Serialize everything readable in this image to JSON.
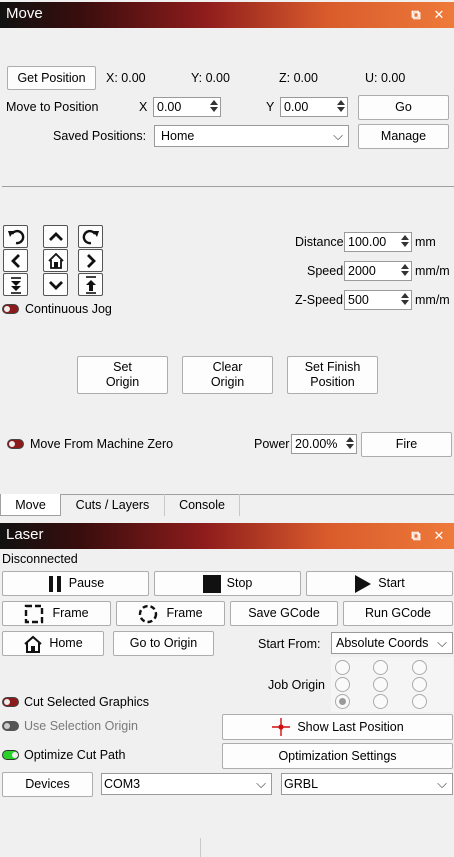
{
  "move_panel": {
    "title": "Move",
    "get_position_label": "Get Position",
    "x_readout": "X: 0.00",
    "y_readout": "Y: 0.00",
    "z_readout": "Z: 0.00",
    "u_readout": "U: 0.00",
    "move_to_position_label": "Move to Position",
    "x_label": "X",
    "x_value": "0.00",
    "y_label": "Y",
    "y_value": "0.00",
    "go_label": "Go",
    "saved_positions_label": "Saved Positions:",
    "saved_positions_value": "Home",
    "manage_label": "Manage",
    "distance_label": "Distance",
    "distance_value": "100.00",
    "distance_unit": "mm",
    "speed_label": "Speed",
    "speed_value": "2000",
    "speed_unit": "mm/m",
    "zspeed_label": "Z-Speed",
    "zspeed_value": "500",
    "zspeed_unit": "mm/m",
    "continuous_jog_label": "Continuous Jog",
    "set_origin_label": "Set\nOrigin",
    "clear_origin_label": "Clear\nOrigin",
    "set_finish_position_label": "Set Finish\nPosition",
    "move_from_machine_zero_label": "Move From Machine Zero",
    "power_label": "Power",
    "power_value": "20.00%",
    "fire_label": "Fire"
  },
  "tabs": [
    "Move",
    "Cuts / Layers",
    "Console"
  ],
  "active_tab": "Move",
  "laser_panel": {
    "title": "Laser",
    "status": "Disconnected",
    "pause_label": "Pause",
    "stop_label": "Stop",
    "start_label": "Start",
    "frame_label": "Frame",
    "frame_circle_label": "Frame",
    "save_gcode_label": "Save GCode",
    "run_gcode_label": "Run GCode",
    "home_label": "Home",
    "go_to_origin_label": "Go to Origin",
    "start_from_label": "Start From:",
    "start_from_value": "Absolute Coords",
    "job_origin_label": "Job Origin",
    "cut_selected_graphics_label": "Cut Selected Graphics",
    "use_selection_origin_label": "Use Selection Origin",
    "optimize_cut_path_label": "Optimize Cut Path",
    "show_last_position_label": "Show Last Position",
    "optimization_settings_label": "Optimization Settings",
    "devices_label": "Devices",
    "port_value": "COM3",
    "controller_value": "GRBL"
  },
  "colors": {
    "toggle_off": "#8b1a1a",
    "toggle_on": "#2bd12b",
    "toggle_disabled": "#555555",
    "accent_red": "#d01010"
  }
}
